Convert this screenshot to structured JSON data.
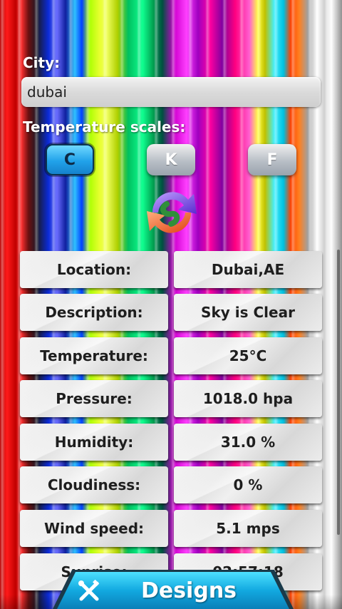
{
  "form": {
    "city_label": "City:",
    "city_value": "dubai",
    "scales_label": "Temperature scales:",
    "scales": [
      {
        "label": "C",
        "active": true
      },
      {
        "label": "K",
        "active": false
      },
      {
        "label": "F",
        "active": false
      }
    ]
  },
  "weather": {
    "rows": [
      {
        "label": "Location:",
        "value": "Dubai,AE"
      },
      {
        "label": "Description:",
        "value": "Sky is Clear"
      },
      {
        "label": "Temperature:",
        "value": "25°C"
      },
      {
        "label": "Pressure:",
        "value": "1018.0 hpa"
      },
      {
        "label": "Humidity:",
        "value": "31.0 %"
      },
      {
        "label": "Cloudiness:",
        "value": "0 %"
      },
      {
        "label": "Wind speed:",
        "value": "5.1 mps"
      },
      {
        "label": "Sunrise:",
        "value": "02:57:18"
      }
    ]
  },
  "bottom_tab": {
    "label": "Designs",
    "icon": "tools-icon"
  },
  "colors": {
    "active_scale": "#21a2ea",
    "tab": "#12a9e0"
  }
}
